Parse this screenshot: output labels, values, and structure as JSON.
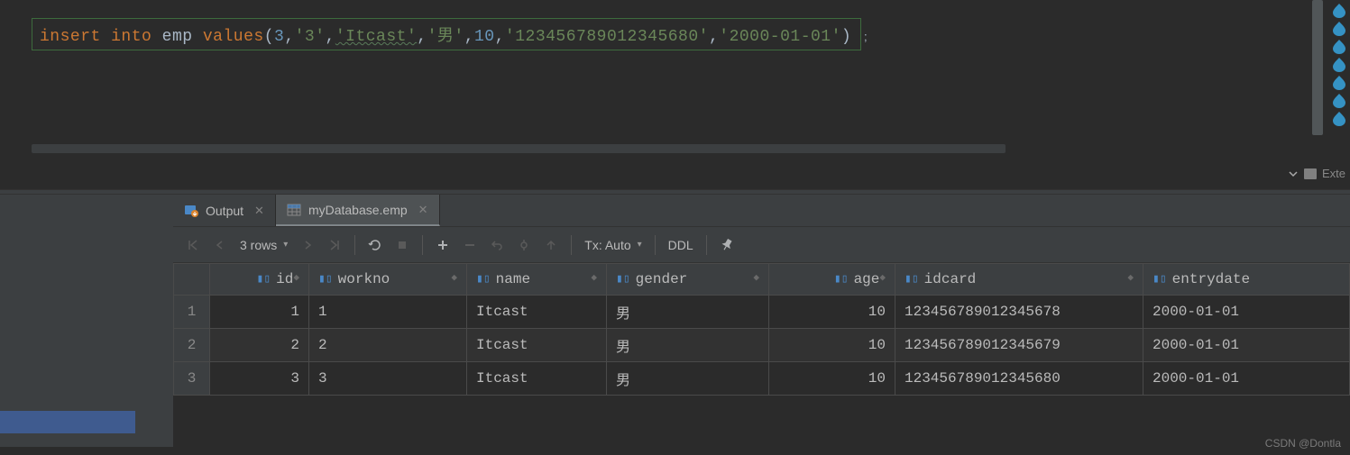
{
  "editor": {
    "sql": {
      "kw1": "insert",
      "kw2": "into",
      "ident1": "emp",
      "kw3": "values",
      "open": "(",
      "num1": "3",
      "c1": ",",
      "str1": "'3'",
      "c2": ",",
      "str2": "'Itcast'",
      "c3": ",",
      "str3": "'男'",
      "c4": ",",
      "num2": "10",
      "c5": ",",
      "str4": "'123456789012345680'",
      "c6": ",",
      "str5": "'2000-01-01'",
      "close": ")",
      "semi": ";"
    }
  },
  "rightPanel": {
    "label": "Exte"
  },
  "tabs": {
    "output": "Output",
    "table": "myDatabase.emp"
  },
  "toolbar": {
    "rowcount": "3 rows",
    "tx": "Tx: Auto",
    "ddl": "DDL"
  },
  "grid": {
    "columns": [
      "id",
      "workno",
      "name",
      "gender",
      "age",
      "idcard",
      "entrydate"
    ],
    "rows": [
      {
        "n": "1",
        "id": "1",
        "workno": "1",
        "name": "Itcast",
        "gender": "男",
        "age": "10",
        "idcard": "123456789012345678",
        "entrydate": "2000-01-01"
      },
      {
        "n": "2",
        "id": "2",
        "workno": "2",
        "name": "Itcast",
        "gender": "男",
        "age": "10",
        "idcard": "123456789012345679",
        "entrydate": "2000-01-01"
      },
      {
        "n": "3",
        "id": "3",
        "workno": "3",
        "name": "Itcast",
        "gender": "男",
        "age": "10",
        "idcard": "123456789012345680",
        "entrydate": "2000-01-01"
      }
    ]
  },
  "watermark": "CSDN @Dontla"
}
